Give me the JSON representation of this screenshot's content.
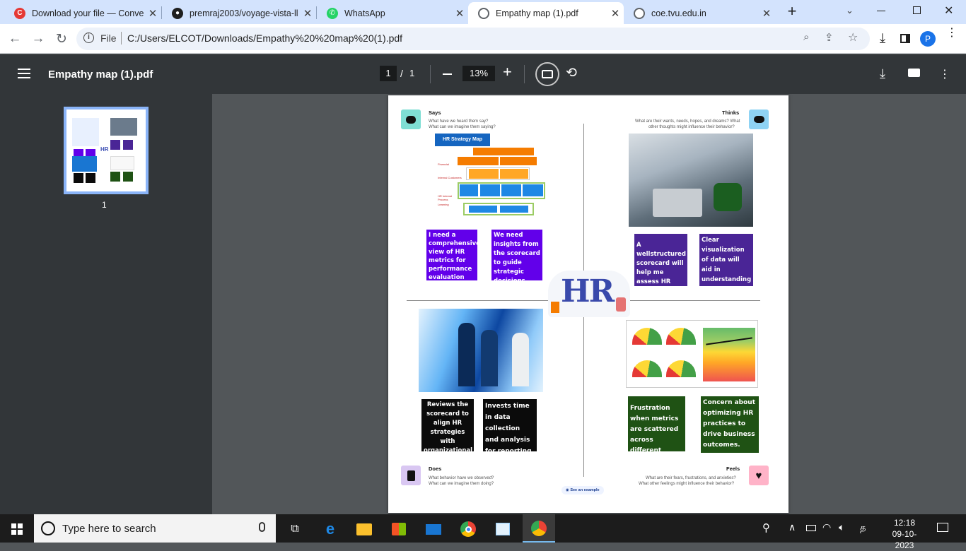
{
  "browser": {
    "tabs": [
      {
        "title": "Download your file — Conve",
        "icon": "pdf-converter-icon",
        "color": "#e53935",
        "active": false
      },
      {
        "title": "premraj2003/voyage-vista-ll",
        "icon": "github-icon",
        "color": "#1f1f1f",
        "active": false
      },
      {
        "title": "WhatsApp",
        "icon": "whatsapp-icon",
        "color": "#25d366",
        "active": false
      },
      {
        "title": "Empathy map (1).pdf",
        "icon": "globe-icon",
        "color": "#5f6368",
        "active": true
      },
      {
        "title": "coe.tvu.edu.in",
        "icon": "globe-icon",
        "color": "#5f6368",
        "active": false
      }
    ],
    "new_tab_label": "+",
    "address": {
      "scheme_label": "File",
      "url": "C:/Users/ELCOT/Downloads/Empathy%20%20map%20(1).pdf"
    },
    "profile_initial": "P"
  },
  "pdf_toolbar": {
    "title": "Empathy map (1).pdf",
    "page_current": "1",
    "page_separator": "/",
    "page_total": "1",
    "zoom": "13%"
  },
  "sidebar": {
    "thumbnail_label": "1"
  },
  "document": {
    "says": {
      "title": "Says",
      "line1": "What have we heard them say?",
      "line2": "What can we imagine them saying?"
    },
    "thinks": {
      "title": "Thinks",
      "line1": "What are their wants, needs, hopes, and dreams? What",
      "line2": "other thoughts might influence their behavior?"
    },
    "does": {
      "title": "Does",
      "line1": "What behavior have we observed?",
      "line2": "What can we imagine them doing?"
    },
    "feels": {
      "title": "Feels",
      "line1": "What are their fears, frustrations, and anxieties?",
      "line2": "What other feelings might influence their behavior?"
    },
    "strategy_map": {
      "title": "HR Strategy Map",
      "rows": [
        "Financial",
        "Internal Customers",
        "HR Internal Process",
        "Learning"
      ]
    },
    "center_logo_text": "HR",
    "see_example": "See an example",
    "colors": {
      "purple": "#6200ea",
      "violet": "#4a2596",
      "black": "#0b0b0b",
      "green": "#1f5214",
      "says_icon": "#7fded4",
      "thinks_icon": "#8fd3f4",
      "does_icon": "#d9c7f2",
      "feels_icon": "#ffb3c8"
    },
    "notes": {
      "says_1": "I need a comprehensive view of HR metrics for performance evaluation",
      "says_2": "We need insights from the scorecard to guide strategic decisions",
      "thinks_1": "A wellstructured scorecard will help me assess HR effectiveness",
      "thinks_2": "Clear visualization of data will aid in understanding HR's impact.",
      "does_1": "Reviews the scorecard to align HR strategies with organizational goals.",
      "does_2": "Invests time in data collection and analysis for reporting.",
      "feels_1": "Frustration when metrics are scattered across different systems",
      "feels_2": "Concern about optimizing HR practices to drive business outcomes."
    }
  },
  "taskbar": {
    "search_placeholder": "Type here to search",
    "time": "12:18",
    "date": "09-10-2023",
    "lang": "த"
  }
}
